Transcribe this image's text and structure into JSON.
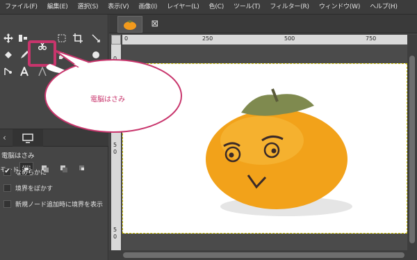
{
  "menu": [
    "ファイル(F)",
    "編集(E)",
    "選択(S)",
    "表示(V)",
    "画像(I)",
    "レイヤー(L)",
    "色(C)",
    "ツール(T)",
    "フィルター(R)",
    "ウィンドウ(W)",
    "ヘルプ(H)"
  ],
  "callout": {
    "text": "電脳はさみ"
  },
  "tool_options": {
    "title": "電脳はさみ",
    "mode_label": "モード:",
    "options": [
      {
        "label": "なめらかに",
        "checked": true
      },
      {
        "label": "境界をぼかす",
        "checked": false
      },
      {
        "label": "新規ノード追加時に境界を表示",
        "checked": false
      }
    ]
  },
  "rulers": {
    "h": [
      "0",
      "250",
      "500",
      "750"
    ],
    "v": [
      "0",
      "5",
      "0",
      "5",
      "0"
    ]
  },
  "highlight_color": "#c8356c",
  "icons": [
    "move-icon",
    "scissors-icon",
    "fuzzy-select-icon",
    "crop-icon",
    "text-icon",
    "display-icon",
    "close-icon"
  ]
}
